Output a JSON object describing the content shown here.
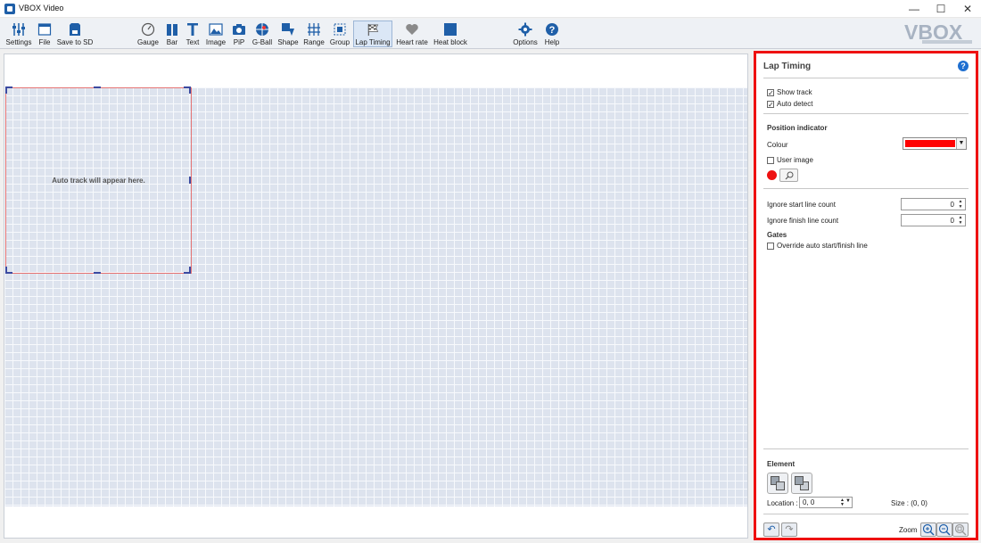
{
  "window": {
    "title": "VBOX Video",
    "controls": {
      "minimize": "—",
      "maximize": "☐",
      "close": "✕"
    }
  },
  "toolbar": {
    "items": [
      {
        "label": "Settings",
        "icon": "settings-sliders-icon"
      },
      {
        "label": "File",
        "icon": "file-icon"
      },
      {
        "label": "Save to SD",
        "icon": "sd-card-icon"
      },
      {
        "label": "Gauge",
        "icon": "gauge-icon"
      },
      {
        "label": "Bar",
        "icon": "bar-icon"
      },
      {
        "label": "Text",
        "icon": "text-icon"
      },
      {
        "label": "Image",
        "icon": "image-icon"
      },
      {
        "label": "PiP",
        "icon": "camera-icon"
      },
      {
        "label": "G-Ball",
        "icon": "g-ball-icon"
      },
      {
        "label": "Shape",
        "icon": "shape-icon"
      },
      {
        "label": "Range",
        "icon": "range-icon"
      },
      {
        "label": "Group",
        "icon": "group-icon"
      },
      {
        "label": "Lap Timing",
        "icon": "lap-timing-flag-icon",
        "active": true
      },
      {
        "label": "Heart rate",
        "icon": "heart-icon"
      },
      {
        "label": "Heat block",
        "icon": "heat-block-icon"
      },
      {
        "label": "Options",
        "icon": "gear-icon"
      },
      {
        "label": "Help",
        "icon": "help-icon"
      }
    ],
    "logo": "VBOX"
  },
  "canvas": {
    "placeholder_text": "Auto track will appear here."
  },
  "panel": {
    "title": "Lap Timing",
    "help": "?",
    "show_track": {
      "label": "Show track",
      "checked": true
    },
    "auto_detect": {
      "label": "Auto detect",
      "checked": true
    },
    "position_indicator_heading": "Position indicator",
    "colour_label": "Colour",
    "colour_value": "#ff0000",
    "user_image": {
      "label": "User image",
      "checked": false
    },
    "ignore_start_label": "Ignore start line count",
    "ignore_start_value": "0",
    "ignore_finish_label": "Ignore finish line count",
    "ignore_finish_value": "0",
    "gates_heading": "Gates",
    "override_gates": {
      "label": "Override auto start/finish line",
      "checked": false
    },
    "element_heading": "Element",
    "location_label": "Location :",
    "location_value": "0, 0",
    "size_text": "Size : (0, 0)",
    "zoom_label": "Zoom"
  },
  "colors": {
    "accent": "#1f5fa8",
    "highlight_border": "#ee1111",
    "grid": "#dde3ee"
  }
}
